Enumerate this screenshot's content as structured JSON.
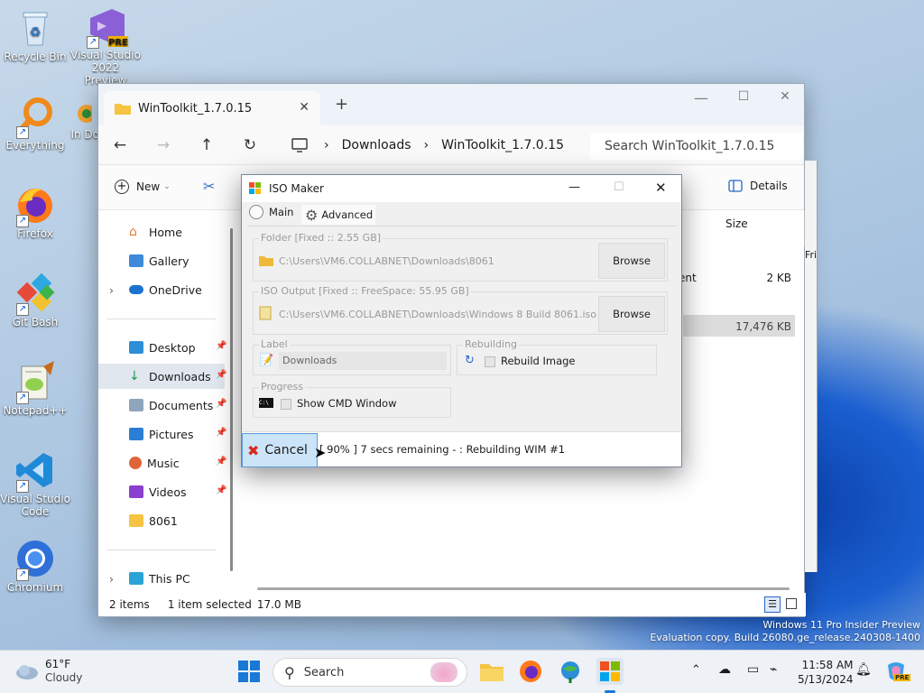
{
  "desktop": {
    "icons": [
      {
        "label": "Recycle Bin"
      },
      {
        "label": "Visual Studio 2022 Preview",
        "badge": "PRE"
      },
      {
        "label": "Everything"
      },
      {
        "label": "Firefox"
      },
      {
        "label": "Git Bash"
      },
      {
        "label": "Notepad++"
      },
      {
        "label": "Visual Studio Code"
      },
      {
        "label": "Chromium"
      }
    ],
    "partial_icon_label": "In Do",
    "watermark_line1": "Windows 11 Pro Insider Preview",
    "watermark_line2": "Evaluation copy. Build 26080.ge_release.240308-1400"
  },
  "explorer": {
    "tab_title": "WinToolkit_1.7.0.15",
    "new_tab": "+",
    "breadcrumb": [
      "Downloads",
      "WinToolkit_1.7.0.15"
    ],
    "search_placeholder": "Search WinToolkit_1.7.0.15",
    "new_label": "New",
    "details_label": "Details",
    "column_size": "Size",
    "rows": [
      {
        "name_partial": "ent",
        "size": "2 KB"
      },
      {
        "size": "17,476 KB"
      }
    ],
    "partial_right": "Fri",
    "sidebar": [
      {
        "label": "Home"
      },
      {
        "label": "Gallery"
      },
      {
        "label": "OneDrive"
      },
      {
        "label": "Desktop"
      },
      {
        "label": "Downloads"
      },
      {
        "label": "Documents"
      },
      {
        "label": "Pictures"
      },
      {
        "label": "Music"
      },
      {
        "label": "Videos"
      },
      {
        "label": "8061"
      },
      {
        "label": "This PC"
      }
    ],
    "status": {
      "items": "2 items",
      "selected": "1 item selected",
      "size": "17.0 MB"
    }
  },
  "iso": {
    "title": "ISO Maker",
    "tab_main": "Main",
    "tab_advanced": "Advanced",
    "folder_legend": "Folder [Fixed :: 2.55 GB]",
    "folder_path": "C:\\Users\\VM6.COLLABNET\\Downloads\\8061",
    "output_legend": "ISO Output [Fixed :: FreeSpace: 55.95 GB]",
    "output_path": "C:\\Users\\VM6.COLLABNET\\Downloads\\Windows 8 Build 8061.iso",
    "browse_label": "Browse",
    "label_legend": "Label",
    "label_value": "Downloads",
    "rebuilding_legend": "Rebuilding",
    "rebuild_image": "Rebuild Image",
    "progress_legend": "Progress",
    "show_cmd": "Show CMD Window",
    "cmd_icon_text": "C:\\",
    "cancel_label": "Cancel",
    "status_text": "[ 90% ] 7 secs remaining - : Rebuilding WIM #1"
  },
  "taskbar": {
    "weather_temp": "61°F",
    "weather_desc": "Cloudy",
    "search_label": "Search",
    "time": "11:58 AM",
    "date": "5/13/2024",
    "copilot_badge": "PRE"
  }
}
